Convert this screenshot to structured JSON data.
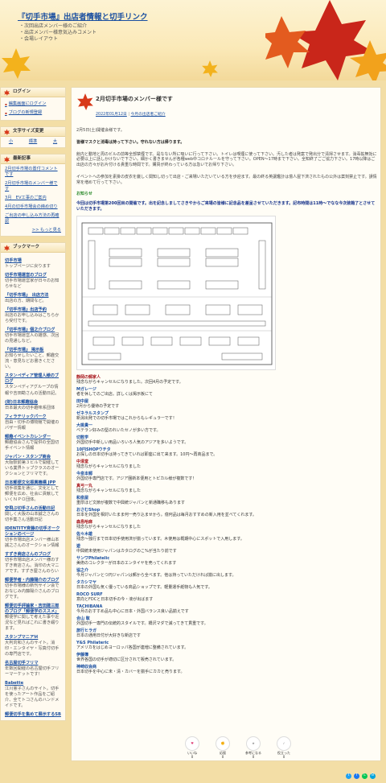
{
  "header": {
    "title": "『切手市場』出店者情報と切手リンク",
    "sub": [
      "・次回出店メンバー様のご紹介",
      "・出店メンバー様意気込みコメント",
      "・会場レイアウト"
    ]
  },
  "sidebar": {
    "login": {
      "title": "ログイン",
      "items": [
        "編集画面にログイン",
        "ブログの新規登録"
      ]
    },
    "font": {
      "title": "文字サイズ変更",
      "small": "小",
      "mid": "標準",
      "large": "大"
    },
    "recent": {
      "title": "最新記事",
      "items": [
        "2月切手市場の置付コメントです",
        "2月切手市場のメンバー様です",
        "3月　EV工事のご案内",
        "4月の切手市場会の締め切り",
        "ご出店の申し込み方法の再確認"
      ],
      "more": ">> もっと見る"
    },
    "bookmarks": {
      "title": "ブックマーク",
      "items": [
        {
          "t": "切手市場",
          "d": "トップページに戻ります"
        },
        {
          "t": "切手市場運営のブログ",
          "d": "切手市場運営家が日々のお知らせなど"
        },
        {
          "t": "『切手市場』　出店方法",
          "d": "出店の方、期間など。"
        },
        {
          "t": "『切手市場』出店予約",
          "d": "出店のお申し込みはこちらから受付です。"
        },
        {
          "t": "『切手市場』個之介ブログ",
          "d": "切手市場運営人の雑感、次回の見通しなど。"
        },
        {
          "t": "『切手市場』 掲示板",
          "d": "お知らせしたいこと、郵趣交流・意見などお書きください。"
        },
        {
          "t": "スタンペディア管理人様のブログ",
          "d": "スタンペディアグループの情報や吉田勘さんの活動日記。"
        },
        {
          "t": "(財)日本郵趣協会",
          "d": "日本最大の切手趣味系団体"
        },
        {
          "t": "フィラテリックパーク",
          "d": "自由・切手の博物館で開催のバザー情報"
        },
        {
          "t": "郵趣イベントカレンダー",
          "d": "郵趣協会さんで提供の全国切手イベント情報"
        },
        {
          "t": "ジャパン・スタンプ商会",
          "d": "大阪駅前第３ビルで開催している業界トップクラスのオークションとフリマです。"
        },
        {
          "t": "日本郵便文化振興機構 JPP",
          "d": "切手収集を通じ、文化として郵便を広め、社会に貢献していくＮＰＯ団体。"
        },
        {
          "t": "空飛ぶ切手さんの活動日記",
          "d": "関しく大阪の山本誠之さんの切手集さん活動日記"
        },
        {
          "t": "IDENTITY斉藤の切手オークションのページ",
          "d": "切手市場出店メンバー様山本誠之さんのオークション情報"
        },
        {
          "t": "すずき商店さんのブログ",
          "d": "切手市場出店メンバー様のすずき商店さん。消印の大マニアです。すずき屋さんのらい"
        },
        {
          "t": "郵便学者・内藤陽介のブログ",
          "d": "切手市場様の新刊サイン会でおなじみ内藤陽介さんのブログです。"
        },
        {
          "t": "郵便切手評論家・吉田建三郎のブログ「郵便学のススメ」",
          "d": "郵便学に関して考えた事や近況など見ればこれに書き綴ります。"
        },
        {
          "t": "スタンプマニアＭ",
          "d": "大判苅和さんのサイト。消印・エンタイヤ・写真付切手の専門店です。"
        },
        {
          "t": "名古屋切手フリマ",
          "d": "年数回開催の名古屋切手フリーマーケットです！"
        },
        {
          "t": "Babette",
          "d": "江川憲子さんのサイト。切手を使ったアート作品をご紹介、全てトコさんのハンドメイドです。"
        },
        {
          "t": "郵便切手を集めて展示するSB",
          "d": ""
        }
      ]
    }
  },
  "article": {
    "title": "2月切手市場のメンバー様です",
    "date": "2022年01月12日",
    "category": "今月の出店者ご紹介",
    "p1": "2月5日(土)開催会様です。",
    "p2": "皆様マスクと消毒は持って下さい。守れない方は帰ります。",
    "p3": "館内と動地と周のビルの前等全部禁煙です。是なない所に吸いに行って下さい。トイレは喫煙に使って下さい。汚した者は発案で発出分で清掃させます。消毒拡無効に必要以上に話しかけないで下さい。細かく書きませんが各種web中コロナルールを守って下さい。OPEN〜17時まで下さい。全知終了ごご協力下さい。17時以降はご出店の方々がお片付ける貴重な時間です。購買が終わっている方は急いでお帰り下さい。",
    "p4": "イベントへの参加を素掛の皮衣を厳しく関知し切って出店・ご来場いただいている方を歩迎ます。最の終る英譲鑑計は億人屋下済されたもの公外は案刻禁止です。誤情常を増めて行って下さい。",
    "notice": "お知らせ",
    "announce": "今回は切手市場第200回目の開催です。出を記念しましてさきやからご来場の皆様に記念品を差呈させていただきます。記布時間は11時〜でなな今次装箱了とさせていただきます。",
    "dealers": [
      {
        "n": "静岡の郵家人",
        "d": "残念ながらキャンセルになりました。次回4月の予定です。",
        "c": "red"
      },
      {
        "n": "Mガレージ",
        "d": "者を休してのご出店。詳しくは掲示板にて",
        "c": "blue"
      },
      {
        "n": "田中屋",
        "d": "2月から優待の予定です",
        "c": "blue"
      },
      {
        "n": "ゼネラルスタンプ",
        "d": "新潟出発での切手市場ではこれからもレギュラーです！",
        "c": "blue"
      },
      {
        "n": "大桃貴一",
        "d": "ベテラン好みの堅のれいたセノが多い方です。",
        "c": "blue"
      },
      {
        "n": "切数学",
        "d": "外国切手中新しい用品いろいろ人気のアジアを多いようです。",
        "c": "blue"
      },
      {
        "n": "10円SHOPウチタ",
        "d": "お探しの日本切手は持ってきていれば即座に出て来ます。10円〜再商品まで。",
        "c": "blue"
      },
      {
        "n": "中清堂",
        "d": "残念ながらキャンセルになりました",
        "c": "red"
      },
      {
        "n": "今泉本郵",
        "d": "外国切手専門店です。アジア圏新本便用とトピカル様が複数です！",
        "c": "blue"
      },
      {
        "n": "真弓一丸",
        "d": "残念ながらキャンセルになりました",
        "c": "red"
      },
      {
        "n": "和泉屋",
        "d": "重厚ほど文節が複数で中興統ジャパンと新通職移もあります",
        "c": "blue"
      },
      {
        "n": "おさむShop",
        "d": "日本を外国を相対いたまま何一売り込ませから。億何品は毎月おすすめの新入用を並べてくれます。",
        "c": "blue"
      },
      {
        "n": "森島哈麻",
        "d": "残念ながらキャンセルになりました",
        "c": "red"
      },
      {
        "n": "佐々木雄",
        "d": "残念〜独行まで日本切手使用済が揃っています。木使用は概期中心にスポットで入用します。",
        "c": "blue"
      },
      {
        "n": "遊",
        "d": "中興統未使用ジャパンはカタログのこ%が当たり前です",
        "c": "blue"
      },
      {
        "n": "サンワPhilatelic",
        "d": "美術のコレクターが日本のエンタイヤを売ってくれます",
        "c": "blue"
      },
      {
        "n": "協之介",
        "d": "今月ジャパンとつ円ジャパンは郵から全べます。他は持っていただければ揃に出します。",
        "c": "blue"
      },
      {
        "n": "タカシマヤ",
        "d": "日本の外国も気く優っている商品ショップです。軽量運手紙物も人気です。",
        "c": "blue"
      },
      {
        "n": "ROCO SURF",
        "d": "意向とFDCと日本切手の今・液が出ばます",
        "c": "blue"
      },
      {
        "n": "TACHIBANA",
        "d": "今月のおすすめ品も中心に日本・外国バランス良い品揃えです",
        "c": "blue"
      },
      {
        "n": "合山 敬",
        "d": "外国切手一専門の伝統的スタイルです。橋沢マダで滅ってきて貫重です。",
        "c": "blue"
      },
      {
        "n": "旅行ヒラガ",
        "d": "日本の通用日付が大好きな新店です",
        "c": "blue"
      },
      {
        "n": "Y&S Philateric",
        "d": "アメリカをはじめヨーロッパ各国が連増に整備されています。",
        "c": "blue"
      },
      {
        "n": "伊藤簿",
        "d": "世界各国の切手が適切に区分されて販売されています。",
        "c": "blue"
      },
      {
        "n": "神崎収会商",
        "d": "日本切手を中心に未・清・カバーを揃手にカカと売ります。",
        "c": "blue"
      }
    ]
  },
  "reactions": [
    {
      "label": "いいね",
      "count": "0"
    },
    {
      "label": "応援",
      "count": "0"
    },
    {
      "label": "参考になる",
      "count": "0"
    },
    {
      "label": "役立った",
      "count": "0"
    }
  ],
  "colors": {
    "accent": "#1a4fa0",
    "bg": "#f3dea6",
    "leaf": "#d8391a"
  }
}
